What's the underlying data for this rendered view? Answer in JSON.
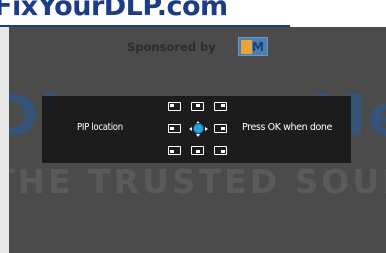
{
  "watermark": {
    "site_title": "FixYourDLP.com",
    "sponsor_text": "Sponsored by",
    "sponsor_logo_text": "M",
    "overlay_main": "Discount-Merch",
    "overlay_sub": "THE TRUSTED SOURCE"
  },
  "pip_menu": {
    "label": "PIP location",
    "hint": "Press OK when done",
    "positions": [
      "top-left",
      "top-center",
      "top-right",
      "middle-left",
      "middle-right",
      "bottom-left",
      "bottom-center",
      "bottom-right"
    ],
    "selected": "center"
  },
  "colors": {
    "title_blue": "#1c3c86",
    "screen_bg": "#4b4b4b",
    "panel_bg": "#1c1c1c",
    "selection_accent": "#2aa3d8"
  }
}
